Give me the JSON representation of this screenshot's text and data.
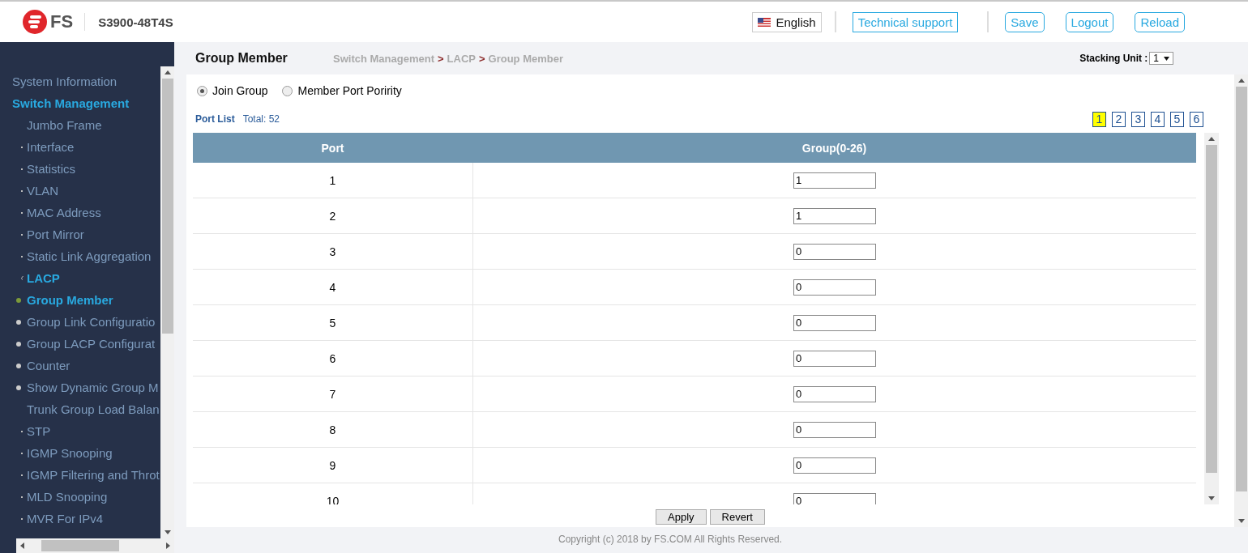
{
  "header": {
    "logo_text": "FS",
    "model": "S3900-48T4S",
    "language": "English",
    "buttons": [
      {
        "label": "Technical support",
        "kind": "square"
      },
      {
        "label": "Save",
        "kind": "round"
      },
      {
        "label": "Logout",
        "kind": "round"
      },
      {
        "label": "Reload",
        "kind": "round"
      }
    ]
  },
  "sidebar": {
    "items": [
      {
        "label": "System Information",
        "selected": false
      },
      {
        "label": "Switch Management",
        "selected": true,
        "children": [
          {
            "label": "Jumbo Frame",
            "kind": "plain",
            "selected": false
          },
          {
            "label": "Interface",
            "kind": "folder",
            "selected": false
          },
          {
            "label": "Statistics",
            "kind": "folder",
            "selected": false
          },
          {
            "label": "VLAN",
            "kind": "folder",
            "selected": false
          },
          {
            "label": "MAC Address",
            "kind": "folder",
            "selected": false
          },
          {
            "label": "Port Mirror",
            "kind": "folder",
            "selected": false
          },
          {
            "label": "Static Link Aggregation",
            "kind": "folder",
            "selected": false
          },
          {
            "label": "LACP",
            "kind": "folder",
            "selected": true,
            "expanded": true,
            "children": [
              {
                "label": "Group Member",
                "kind": "page",
                "selected": true
              },
              {
                "label": "Group Link Configuratio",
                "kind": "page",
                "selected": false
              },
              {
                "label": "Group LACP Configurat",
                "kind": "page",
                "selected": false
              },
              {
                "label": "Counter",
                "kind": "page",
                "selected": false
              },
              {
                "label": "Show Dynamic Group M",
                "kind": "page",
                "selected": false
              }
            ]
          },
          {
            "label": "Trunk Group Load Balan",
            "kind": "plain",
            "selected": false
          },
          {
            "label": "STP",
            "kind": "folder",
            "selected": false
          },
          {
            "label": "IGMP Snooping",
            "kind": "folder",
            "selected": false
          },
          {
            "label": "IGMP Filtering and Throt",
            "kind": "folder",
            "selected": false
          },
          {
            "label": "MLD Snooping",
            "kind": "folder",
            "selected": false
          },
          {
            "label": "MVR For IPv4",
            "kind": "folder",
            "selected": false
          }
        ]
      }
    ]
  },
  "page": {
    "title": "Group Member",
    "breadcrumb": [
      "Switch Management",
      "LACP",
      "Group Member"
    ],
    "breadcrumb_separator": ">",
    "stacking_unit": {
      "label": "Stacking Unit :",
      "value": "1"
    },
    "radios": [
      {
        "label": "Join Group",
        "selected": true
      },
      {
        "label": "Member Port Poririty",
        "selected": false
      }
    ],
    "port_list": {
      "label": "Port List",
      "total": "Total: 52"
    },
    "pages": [
      {
        "label": "1",
        "selected": true
      },
      {
        "label": "2",
        "selected": false
      },
      {
        "label": "3",
        "selected": false
      },
      {
        "label": "4",
        "selected": false
      },
      {
        "label": "5",
        "selected": false
      },
      {
        "label": "6",
        "selected": false
      }
    ],
    "table": {
      "columns": [
        "Port",
        "Group(0-26)"
      ],
      "rows": [
        {
          "port": "1",
          "group": "1"
        },
        {
          "port": "2",
          "group": "1"
        },
        {
          "port": "3",
          "group": "0"
        },
        {
          "port": "4",
          "group": "0"
        },
        {
          "port": "5",
          "group": "0"
        },
        {
          "port": "6",
          "group": "0"
        },
        {
          "port": "7",
          "group": "0"
        },
        {
          "port": "8",
          "group": "0"
        },
        {
          "port": "9",
          "group": "0"
        },
        {
          "port": "10",
          "group": "0"
        }
      ]
    },
    "buttons": [
      "Apply",
      "Revert"
    ]
  },
  "footer": "Copyright (c) 2018 by FS.COM All Rights Reserved."
}
